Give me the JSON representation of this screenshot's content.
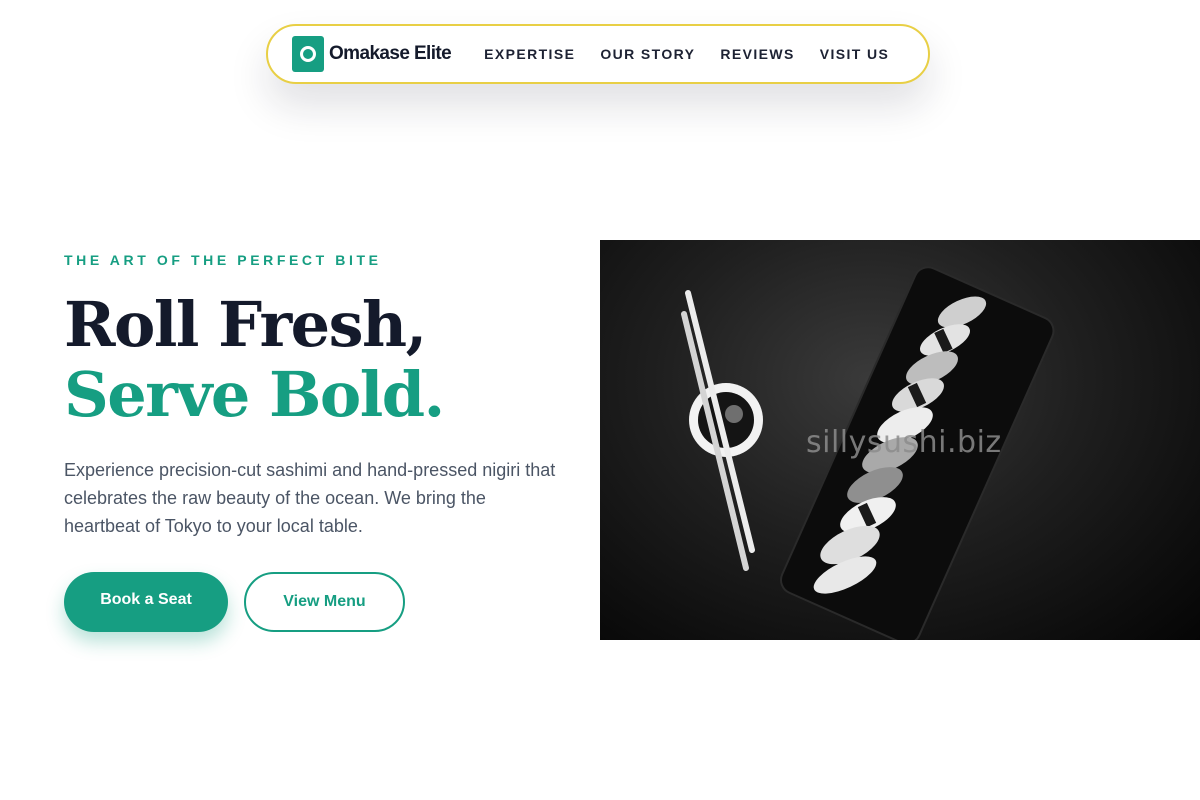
{
  "nav": {
    "brand_initial": "O",
    "brand_name": "Omakase Elite",
    "links": [
      "EXPERTISE",
      "OUR STORY",
      "REVIEWS",
      "VISIT US"
    ]
  },
  "hero": {
    "eyebrow": "THE ART OF THE PERFECT BITE",
    "headline_line1": "Roll Fresh,",
    "headline_line2": "Serve Bold.",
    "description": "Experience precision-cut sashimi and hand-pressed nigiri that celebrates the raw beauty of the ocean. We bring the heartbeat of Tokyo to your local table.",
    "primary_button": "Book a Seat",
    "secondary_button": "View Menu",
    "image_watermark": "sillysushi.biz"
  },
  "colors": {
    "accent": "#169e82",
    "nav_border": "#e8cf45",
    "heading": "#141a2b",
    "body_text": "#4b5565"
  }
}
